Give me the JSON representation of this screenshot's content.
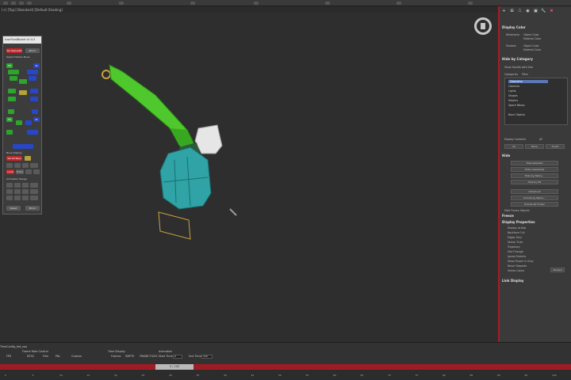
{
  "viewport": {
    "label": "[+] [Top] [Standard] [Default Shading]"
  },
  "script_panel": {
    "title": "IconFloatBoard v0.4.5",
    "buttons": [
      "Sel Opposite",
      "Mirror",
      "Select Hidden Bone",
      "FK",
      "IK",
      "FK",
      "IK",
      "Sel All Keys",
      "Limb",
      "Trunk",
      "Reset",
      "Mirror"
    ],
    "section_labels": [
      "Bone Display",
      "Animation Range"
    ]
  },
  "command_panel": {
    "tabs": [
      "+",
      "⊞",
      "⎍",
      "◉",
      "▣",
      "🔧",
      "✖"
    ],
    "display_color": {
      "head": "Display Color",
      "wireframe_label": "Wireframe:",
      "shaded_label": "Shaded:",
      "object_color": "Object Color",
      "material_color": "Material Color"
    },
    "hide_by_category": {
      "head": "Hide by Category",
      "show_handles": "Show Handle with Geo",
      "tabs": [
        "Categories",
        "Filter"
      ],
      "items": [
        "Geometry",
        "Cameras",
        "Lights",
        "Shapes",
        "Helpers",
        "Space Warps",
        "Bone Objects"
      ],
      "display_contents": "Display Contents",
      "all": "All",
      "buttons": [
        "All",
        "None",
        "Invert"
      ]
    },
    "hide": {
      "head": "Hide",
      "buttons": [
        "Hide Selected",
        "Hide Unselected",
        "Hide by Name...",
        "Hide by Hit",
        "Unhide All",
        "Unhide by Name...",
        "Unhide All Frozen"
      ],
      "hide_frozen": "Hide Frozen Objects"
    },
    "freeze": {
      "head": "Freeze"
    },
    "display_properties": {
      "head": "Display Properties",
      "items": [
        "Display as Box",
        "Backface Cull",
        "Edges Only",
        "Vertex Ticks",
        "Trajectory",
        "See-Through",
        "Ignore Extents",
        "Show Frozen in Gray",
        "Never Degrade",
        "Vertex Colors"
      ],
      "shaded_btn": "Shaded"
    },
    "link_display": {
      "head": "Link Display"
    }
  },
  "status_bar": {
    "file_label": "TimeConfig_ted_zoo",
    "frame_rate": "Frame Rate Control",
    "time_display": "Time Display",
    "animation": "Animation",
    "options": [
      "FPS",
      "NTSC",
      "Film",
      "PAL",
      "Custom"
    ],
    "time_options": [
      "Frames",
      "SMPTE",
      "FRAME:TICKS"
    ],
    "start_time_label": "Start Time:",
    "start_time": "0",
    "end_time_label": "End Time:",
    "end_time": "100"
  },
  "timeline": {
    "slider_label": "0 / 100",
    "ticks": [
      "0",
      "5",
      "10",
      "15",
      "20",
      "25",
      "30",
      "35",
      "40",
      "45",
      "50",
      "55",
      "60",
      "65",
      "70",
      "75",
      "80",
      "85",
      "90",
      "95",
      "100"
    ]
  },
  "colors": {
    "accent_red": "#a01c24",
    "mesh_green": "#4ec82c",
    "mesh_teal": "#2fa3a5",
    "mesh_white": "#e6e6e6",
    "selection_yellow": "#c8a43c"
  }
}
